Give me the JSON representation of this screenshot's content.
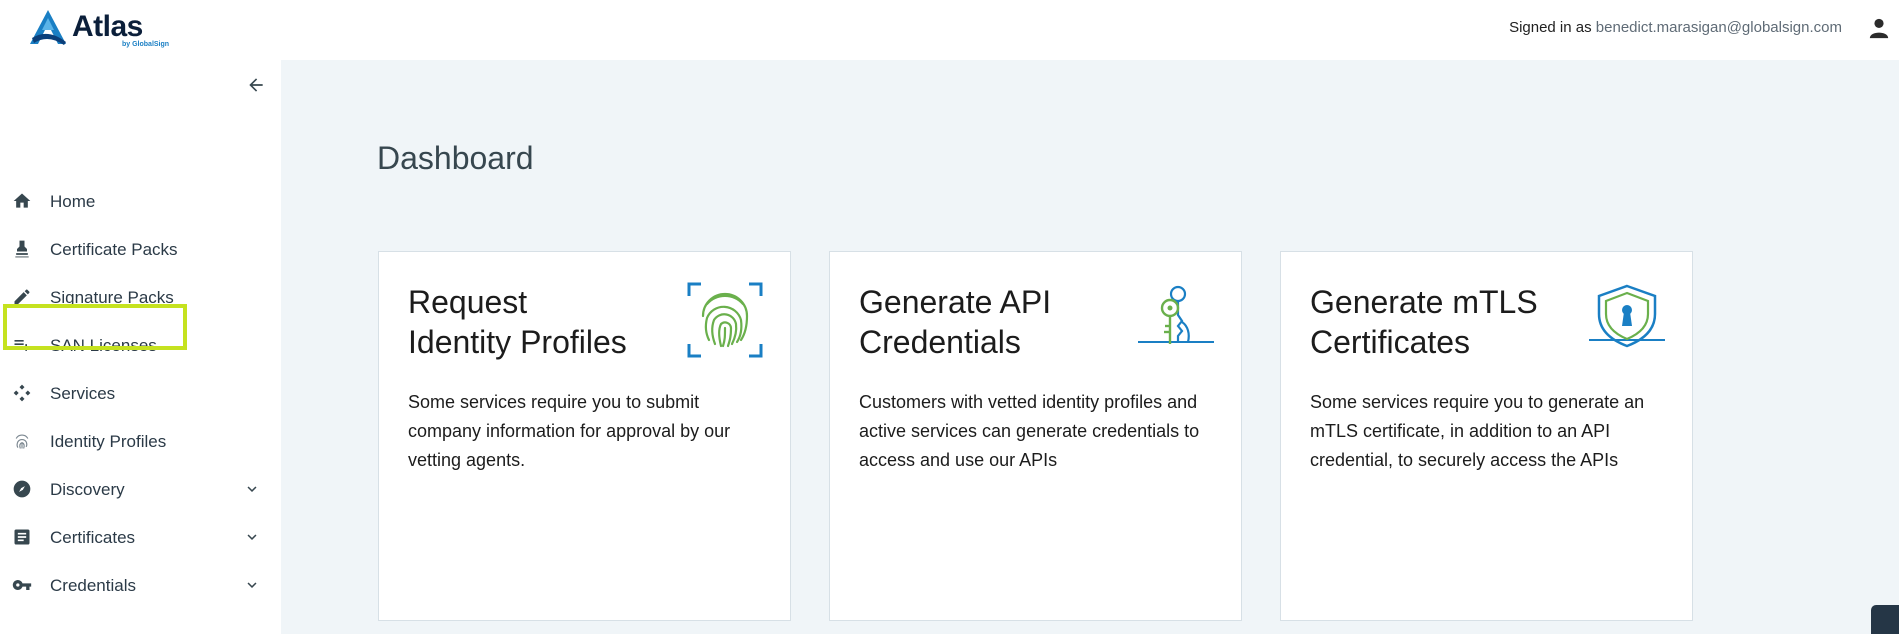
{
  "app": {
    "logo_text": "Atlas",
    "logo_by": "by GlobalSign"
  },
  "header": {
    "signed_in_label": "Signed in as",
    "user_email": "benedict.marasigan@globalsign.com",
    "user_icon": "account-icon"
  },
  "sidebar": {
    "collapse_icon": "arrow-left-icon",
    "items": [
      {
        "label": "Home",
        "icon": "home-icon",
        "expandable": false
      },
      {
        "label": "Certificate Packs",
        "icon": "stamp-icon",
        "expandable": false
      },
      {
        "label": "Signature Packs",
        "icon": "pencil-icon",
        "expandable": false
      },
      {
        "label": "SAN Licenses",
        "icon": "playlist-add-icon",
        "expandable": false,
        "highlighted": true
      },
      {
        "label": "Services",
        "icon": "services-icon",
        "expandable": false
      },
      {
        "label": "Identity Profiles",
        "icon": "fingerprint-icon",
        "expandable": false
      },
      {
        "label": "Discovery",
        "icon": "compass-icon",
        "expandable": true
      },
      {
        "label": "Certificates",
        "icon": "document-icon",
        "expandable": true
      },
      {
        "label": "Credentials",
        "icon": "key-icon",
        "expandable": true
      }
    ]
  },
  "main": {
    "title": "Dashboard",
    "cards": [
      {
        "title_line1": "Request",
        "title_line2": "Identity Profiles",
        "text": "Some services require you to submit company information for approval by our vetting agents.",
        "icon": "fingerprint-scan-icon"
      },
      {
        "title_line1": "Generate API",
        "title_line2": "Credentials",
        "text": "Customers with vetted identity profiles and active services can generate credentials to access and use our APIs",
        "icon": "keys-icon"
      },
      {
        "title_line1": "Generate mTLS",
        "title_line2": "Certificates",
        "text": "Some services require you to generate an mTLS certificate, in addition to an API credential, to securely access the APIs",
        "icon": "shield-lock-icon"
      }
    ]
  },
  "colors": {
    "highlight": "#c5e21f",
    "main_background": "#f0f5f8",
    "brand_blue": "#1a7fc4",
    "icon_green": "#6ab04c"
  }
}
